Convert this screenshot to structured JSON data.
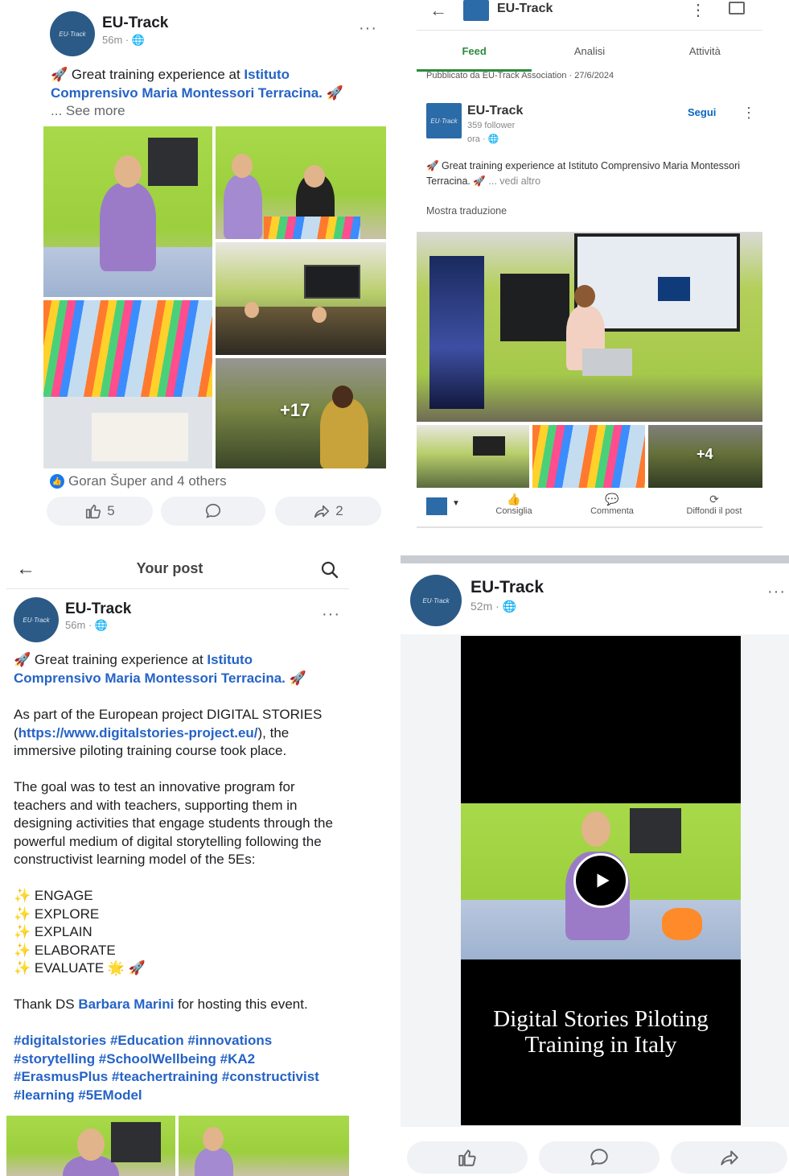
{
  "fb1": {
    "page_name": "EU-Track",
    "meta": "56m · ",
    "text_prefix": "🚀 Great training experience at ",
    "text_link": "Istituto Comprensivo Maria Montessori Terracina.",
    "text_suffix": " 🚀",
    "see_more": "... See more",
    "more_photos": "+17",
    "reactions_text": "Goran Šuper and 4 others",
    "like_count": "5",
    "share_count": "2",
    "icons": [
      "like-icon",
      "comment-icon",
      "share-icon",
      "globe-icon",
      "more-icon"
    ]
  },
  "linkedin": {
    "page_name": "EU-Track",
    "tabs": [
      "Feed",
      "Analisi",
      "Attività"
    ],
    "active_tab": "Feed",
    "published": "Pubblicato da EU-Track Association · 27/6/2024",
    "followers": "359 follower",
    "time": "ora · ",
    "follow": "Segui",
    "text_prefix": "🚀 Great training experience at Istituto Comprensivo Maria Montessori Terracina. 🚀",
    "see_more": "... vedi altro",
    "translate": "Mostra traduzione",
    "more_photos": "+4",
    "actions": [
      "Consiglia",
      "Commenta",
      "Diffondi il post"
    ],
    "accent": "#2e8a3e"
  },
  "fb2": {
    "header_title": "Your post",
    "page_name": "EU-Track",
    "meta": "56m · ",
    "headline_prefix": "🚀 Great training experience at ",
    "headline_link": "Istituto Comprensivo Maria Montessori Terracina.",
    "headline_suffix": " 🚀",
    "p1_prefix": "As part of the European project DIGITAL STORIES (",
    "p1_link": "https://www.digitalstories-project.eu/",
    "p1_suffix": "), the immersive piloting training course took place.",
    "p2": "The goal was to test an innovative program for teachers and with teachers, supporting them in designing activities that engage students through the powerful medium of digital storytelling following the constructivist learning model of the 5Es:",
    "list": [
      "ENGAGE",
      "EXPLORE",
      "EXPLAIN",
      "ELABORATE",
      "EVALUATE"
    ],
    "thanks_prefix": "Thank DS ",
    "thanks_link": "Barbara Marini",
    "thanks_suffix": " for hosting this event.",
    "hashtags": "#digitalstories #Education #innovations #storytelling #SchoolWellbeing #KA2 #ErasmusPlus #teachertraining #constructivist #learning #5EModel"
  },
  "fb3": {
    "page_name": "EU-Track",
    "meta": "52m · ",
    "video_title_line1": "Digital Stories Piloting",
    "video_title_line2": "Training in Italy"
  }
}
